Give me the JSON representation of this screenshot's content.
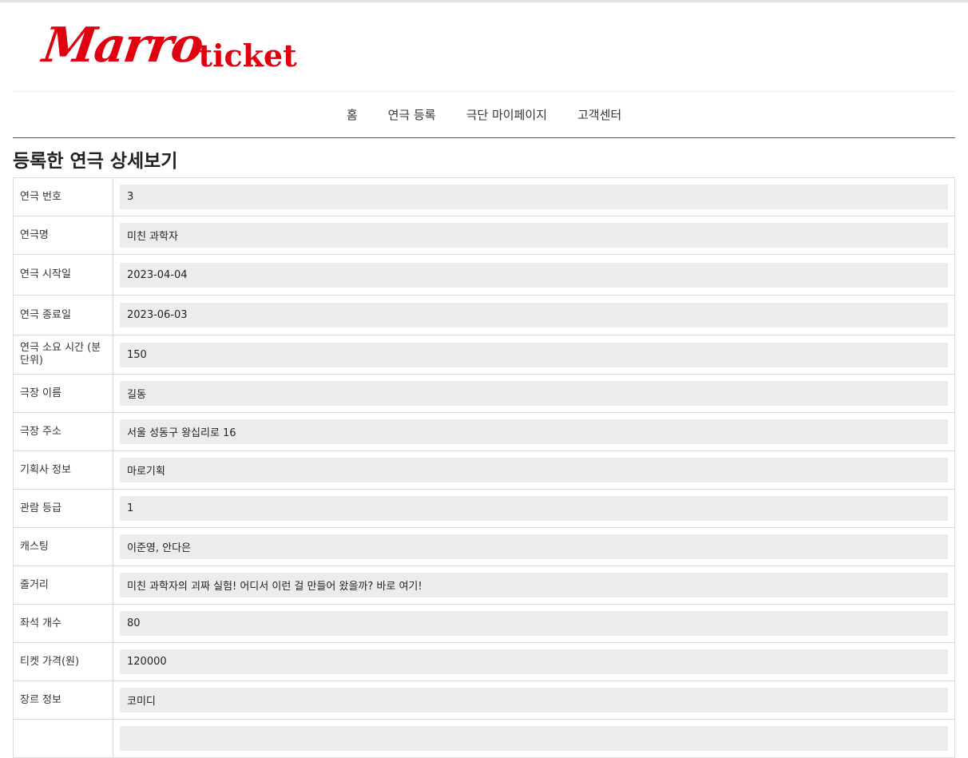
{
  "logo": {
    "script": "Marro",
    "word": "ticket"
  },
  "nav": [
    {
      "label": "홈"
    },
    {
      "label": "연극 등록"
    },
    {
      "label": "극단 마이페이지"
    },
    {
      "label": "고객센터"
    }
  ],
  "page_title": "등록한 연극 상세보기",
  "rows": [
    {
      "label": "연극 번호",
      "value": "3"
    },
    {
      "label": "연극명",
      "value": "미친 과학자"
    },
    {
      "label": "연극 시작일",
      "value": "2023-04-04"
    },
    {
      "label": "연극 종료일",
      "value": "2023-06-03"
    },
    {
      "label": "연극 소요 시간 (분단위)",
      "value": "150"
    },
    {
      "label": "극장 이름",
      "value": "길동"
    },
    {
      "label": "극장 주소",
      "value": "서울 성동구 왕십리로 16"
    },
    {
      "label": "기획사 정보",
      "value": "마로기획"
    },
    {
      "label": "관람 등급",
      "value": "1"
    },
    {
      "label": "캐스팅",
      "value": "이준영, 안다은"
    },
    {
      "label": "줄거리",
      "value": "미친 과학자의 괴짜 실험! 어디서 이런 걸 만들어 왔을까? 바로 여기!"
    },
    {
      "label": "좌석 개수",
      "value": "80"
    },
    {
      "label": "티켓 가격(원)",
      "value": "120000"
    },
    {
      "label": "장르 정보",
      "value": "코미디"
    },
    {
      "label": "",
      "value": ""
    }
  ]
}
